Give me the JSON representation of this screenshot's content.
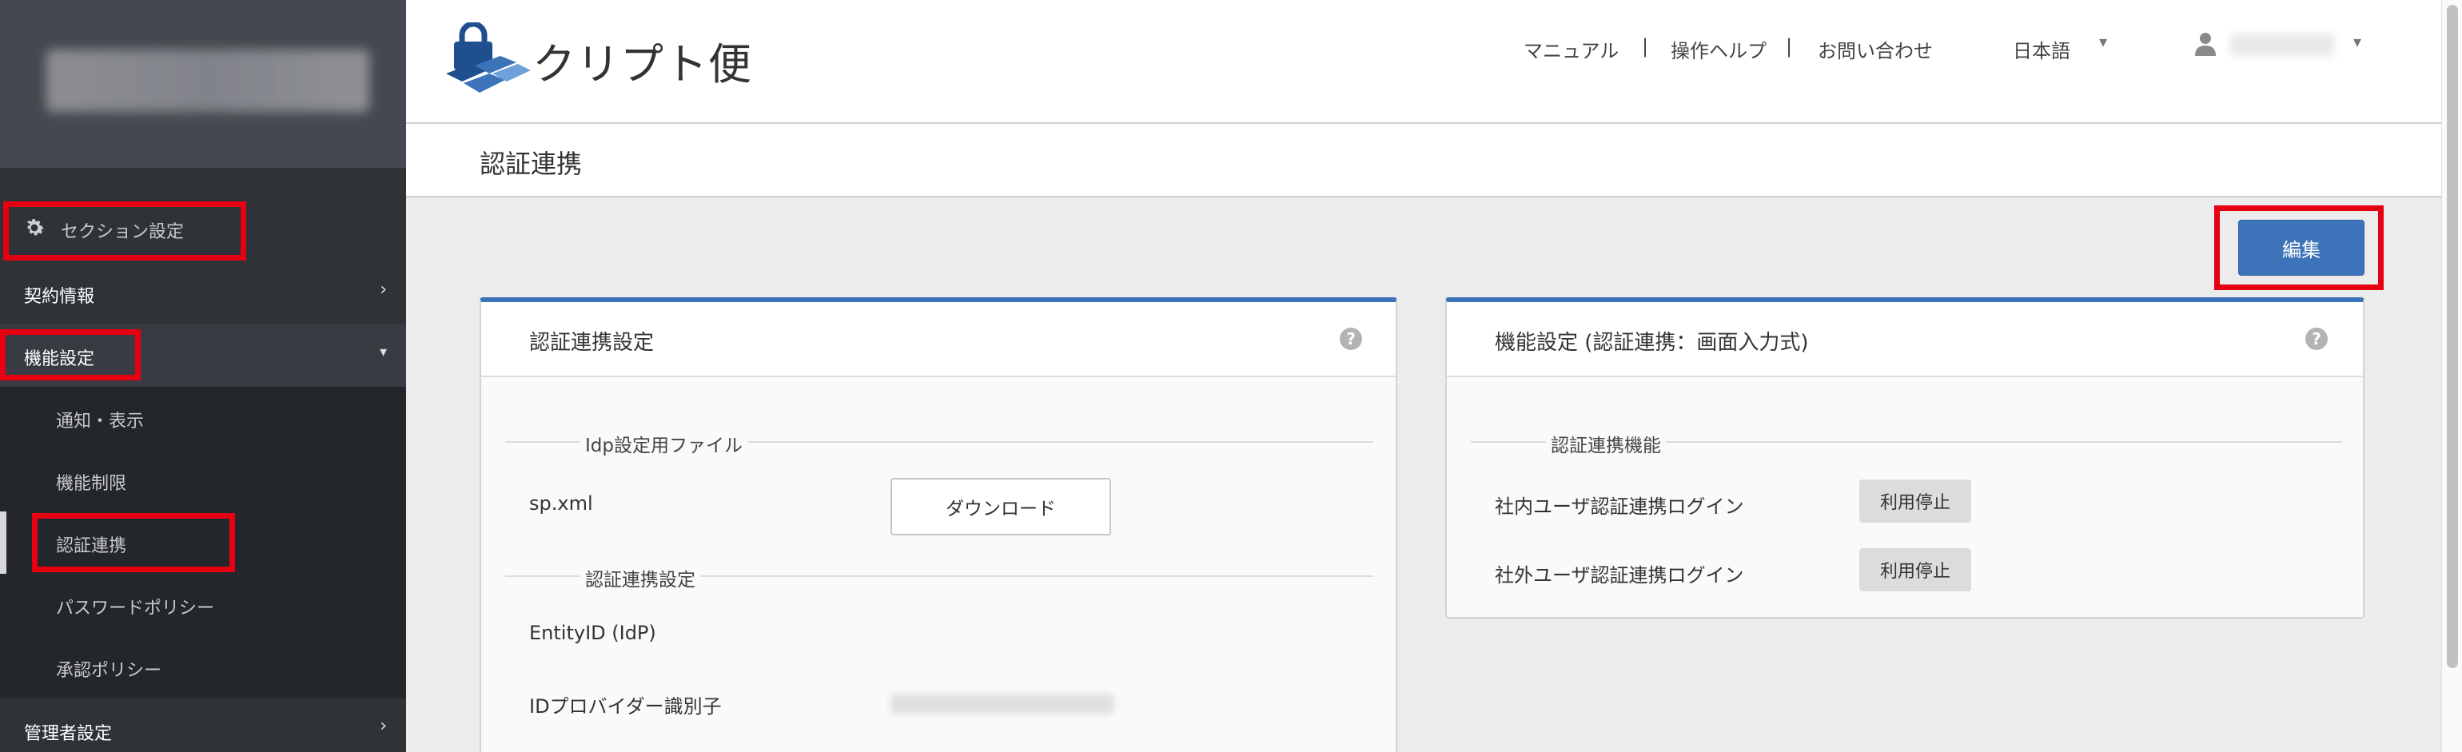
{
  "app": {
    "logo_text": "クリプト便"
  },
  "header": {
    "nav": [
      "マニュアル",
      "|",
      "操作ヘルプ",
      "|",
      "お問い合わせ"
    ],
    "language": "日本語"
  },
  "sidebar": {
    "section_label": "セクション設定",
    "items": [
      {
        "label": "契約情報"
      },
      {
        "label": "機能設定"
      },
      {
        "label": "通知・表示"
      },
      {
        "label": "機能制限"
      },
      {
        "label": "認証連携"
      },
      {
        "label": "パスワードポリシー"
      },
      {
        "label": "承認ポリシー"
      },
      {
        "label": "管理者設定"
      }
    ]
  },
  "page": {
    "title": "認証連携",
    "edit_label": "編集"
  },
  "card_left": {
    "title": "認証連携設定",
    "section1": "Idp設定用ファイル",
    "file_label": "sp.xml",
    "download_label": "ダウンロード",
    "section2": "認証連携設定",
    "entity_label": "EntityID (IdP)",
    "idp_label": "IDプロバイダー識別子"
  },
  "card_right": {
    "title": "機能設定 (認証連携：画面入力式)",
    "section": "認証連携機能",
    "rows": [
      {
        "label": "社内ユーザ認証連携ログイン",
        "status": "利用停止"
      },
      {
        "label": "社外ユーザ認証連携ログイン",
        "status": "利用停止"
      }
    ]
  },
  "help_glyph": "?",
  "colors": {
    "accent": "#3d74b9",
    "highlight": "#e60012",
    "sidebar": "#2f3338"
  }
}
